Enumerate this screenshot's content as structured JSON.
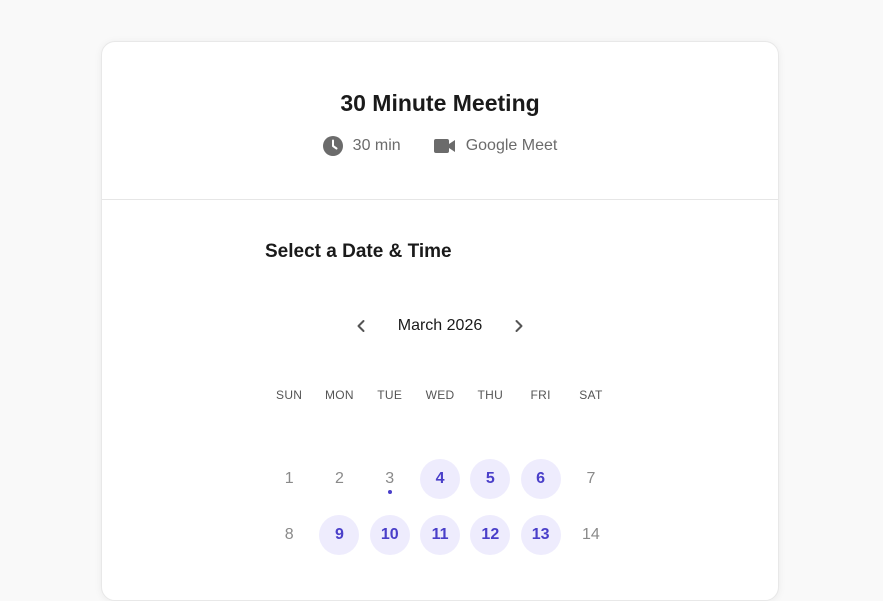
{
  "event": {
    "title": "30 Minute Meeting",
    "duration": "30 min",
    "location": "Google Meet",
    "duration_icon": "clock-icon",
    "location_icon": "video-camera-icon"
  },
  "scheduler": {
    "section_title": "Select a Date & Time",
    "month_label": "March 2026",
    "prev_icon": "chevron-left-icon",
    "next_icon": "chevron-right-icon",
    "weekdays": [
      "SUN",
      "MON",
      "TUE",
      "WED",
      "THU",
      "FRI",
      "SAT"
    ],
    "days": [
      {
        "label": "1",
        "available": false,
        "today": false
      },
      {
        "label": "2",
        "available": false,
        "today": false
      },
      {
        "label": "3",
        "available": false,
        "today": true
      },
      {
        "label": "4",
        "available": true,
        "today": false
      },
      {
        "label": "5",
        "available": true,
        "today": false
      },
      {
        "label": "6",
        "available": true,
        "today": false
      },
      {
        "label": "7",
        "available": false,
        "today": false
      },
      {
        "label": "8",
        "available": false,
        "today": false
      },
      {
        "label": "9",
        "available": true,
        "today": false
      },
      {
        "label": "10",
        "available": true,
        "today": false
      },
      {
        "label": "11",
        "available": true,
        "today": false
      },
      {
        "label": "12",
        "available": true,
        "today": false
      },
      {
        "label": "13",
        "available": true,
        "today": false
      },
      {
        "label": "14",
        "available": false,
        "today": false
      }
    ]
  },
  "colors": {
    "accent": "#4a3fc9",
    "available_bg": "#eeecfd",
    "muted_text": "#8a8a8a",
    "page_bg": "#f9f9f9"
  }
}
